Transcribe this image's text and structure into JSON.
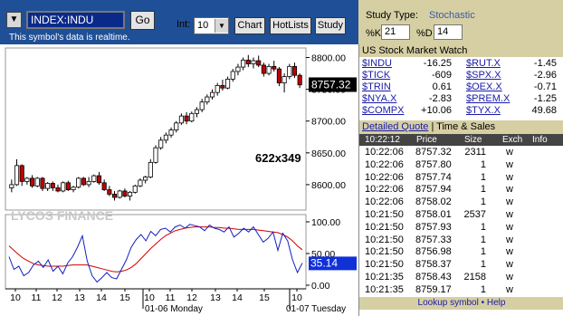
{
  "toolbar": {
    "menu_icon": "▼",
    "symbol_value": "INDEX:INDU",
    "go_label": "Go",
    "realtime_text": "This symbol's data is realtime.",
    "int_label": "Int:",
    "int_value": "10",
    "chart_label": "Chart",
    "hotlists_label": "HotLists",
    "study_label": "Study"
  },
  "study": {
    "type_label": "Study Type:",
    "type_value": "Stochastic",
    "k_label": "%K",
    "k_value": "21",
    "d_label": "%D",
    "d_value": "14"
  },
  "chart": {
    "price_label": "8757.32",
    "stoch_label": "35.14",
    "size_text": "622x349",
    "watermark": "LYCOS FINANCE",
    "price_ticks": [
      "8800.00",
      "8750.00",
      "8700.00",
      "8650.00",
      "8600.00"
    ],
    "stoch_ticks": [
      "100.00",
      "50.00",
      "0.00"
    ],
    "x_ticks": [
      "10",
      "11",
      "12",
      "13",
      "14",
      "15",
      "10",
      "11",
      "12",
      "13",
      "14",
      "15",
      "10"
    ],
    "day1": "01-06 Monday",
    "day2": "01-07 Tuesday"
  },
  "chart_data": {
    "type": "candlestick",
    "price_ylim": [
      8560,
      8815
    ],
    "stoch_ylim": [
      0,
      100
    ],
    "current_price": 8757.32,
    "current_stoch": 35.14,
    "candles": [
      [
        8595,
        8608,
        8588,
        8600
      ],
      [
        8600,
        8640,
        8598,
        8630
      ],
      [
        8630,
        8632,
        8598,
        8605
      ],
      [
        8605,
        8612,
        8600,
        8610
      ],
      [
        8610,
        8615,
        8595,
        8598
      ],
      [
        8598,
        8612,
        8596,
        8610
      ],
      [
        8610,
        8612,
        8590,
        8594
      ],
      [
        8594,
        8604,
        8590,
        8602
      ],
      [
        8602,
        8605,
        8590,
        8595
      ],
      [
        8595,
        8600,
        8588,
        8590
      ],
      [
        8590,
        8605,
        8588,
        8603
      ],
      [
        8603,
        8606,
        8590,
        8592
      ],
      [
        8592,
        8598,
        8588,
        8596
      ],
      [
        8596,
        8612,
        8594,
        8610
      ],
      [
        8610,
        8612,
        8598,
        8600
      ],
      [
        8600,
        8612,
        8596,
        8605
      ],
      [
        8605,
        8616,
        8603,
        8614
      ],
      [
        8614,
        8620,
        8600,
        8603
      ],
      [
        8603,
        8608,
        8590,
        8592
      ],
      [
        8592,
        8598,
        8582,
        8585
      ],
      [
        8585,
        8590,
        8575,
        8580
      ],
      [
        8580,
        8592,
        8578,
        8590
      ],
      [
        8590,
        8594,
        8580,
        8582
      ],
      [
        8582,
        8590,
        8575,
        8588
      ],
      [
        8588,
        8600,
        8586,
        8598
      ],
      [
        8598,
        8610,
        8596,
        8607
      ],
      [
        8607,
        8614,
        8602,
        8612
      ],
      [
        8612,
        8640,
        8610,
        8635
      ],
      [
        8635,
        8662,
        8633,
        8658
      ],
      [
        8658,
        8675,
        8655,
        8670
      ],
      [
        8670,
        8682,
        8665,
        8678
      ],
      [
        8678,
        8690,
        8674,
        8686
      ],
      [
        8686,
        8700,
        8682,
        8697
      ],
      [
        8697,
        8712,
        8694,
        8708
      ],
      [
        8708,
        8714,
        8695,
        8700
      ],
      [
        8700,
        8715,
        8698,
        8712
      ],
      [
        8712,
        8722,
        8706,
        8718
      ],
      [
        8718,
        8735,
        8714,
        8730
      ],
      [
        8730,
        8742,
        8726,
        8738
      ],
      [
        8738,
        8750,
        8734,
        8745
      ],
      [
        8745,
        8760,
        8740,
        8756
      ],
      [
        8756,
        8765,
        8748,
        8752
      ],
      [
        8752,
        8770,
        8750,
        8766
      ],
      [
        8766,
        8782,
        8762,
        8778
      ],
      [
        8778,
        8790,
        8772,
        8785
      ],
      [
        8785,
        8800,
        8780,
        8796
      ],
      [
        8796,
        8804,
        8785,
        8790
      ],
      [
        8790,
        8800,
        8783,
        8795
      ],
      [
        8795,
        8803,
        8785,
        8788
      ],
      [
        8788,
        8792,
        8770,
        8775
      ],
      [
        8775,
        8790,
        8772,
        8786
      ],
      [
        8786,
        8795,
        8778,
        8782
      ],
      [
        8782,
        8785,
        8755,
        8760
      ],
      [
        8760,
        8775,
        8745,
        8770
      ],
      [
        8770,
        8790,
        8766,
        8786
      ],
      [
        8786,
        8792,
        8768,
        8772
      ],
      [
        8772,
        8775,
        8752,
        8757
      ]
    ],
    "stoch_k": [
      45,
      25,
      30,
      15,
      20,
      32,
      38,
      28,
      40,
      22,
      30,
      18,
      35,
      45,
      60,
      78,
      38,
      15,
      5,
      12,
      20,
      12,
      10,
      25,
      40,
      60,
      72,
      80,
      70,
      85,
      78,
      88,
      90,
      84,
      92,
      95,
      90,
      96,
      94,
      92,
      86,
      95,
      90,
      88,
      84,
      92,
      76,
      82,
      90,
      84,
      92,
      80,
      68,
      74,
      84,
      55,
      82,
      70,
      40,
      20,
      35
    ],
    "stoch_d": [
      62,
      55,
      48,
      42,
      38,
      34,
      32,
      31,
      30,
      30,
      30,
      30,
      31,
      32,
      32,
      32,
      32,
      30,
      28,
      26,
      24,
      22,
      21,
      22,
      24,
      28,
      34,
      42,
      50,
      58,
      65,
      72,
      78,
      82,
      86,
      88,
      90,
      91,
      92,
      92,
      92,
      92,
      91,
      91,
      90,
      90,
      89,
      88,
      88,
      88,
      88,
      87,
      86,
      85,
      84,
      83,
      80,
      76,
      70,
      62,
      56
    ]
  },
  "watch": {
    "title": "US Stock Market Watch",
    "rows": [
      {
        "s1": "$INDU",
        "v1": "-16.25",
        "s2": "$RUT.X",
        "v2": "-1.45"
      },
      {
        "s1": "$TICK",
        "v1": "-609",
        "s2": "$SPX.X",
        "v2": "-2.96"
      },
      {
        "s1": "$TRIN",
        "v1": "0.61",
        "s2": "$OEX.X",
        "v2": "-0.71"
      },
      {
        "s1": "$NYA.X",
        "v1": "-2.83",
        "s2": "$PREM.X",
        "v2": "-1.25"
      },
      {
        "s1": "$COMPX",
        "v1": "+10.06",
        "s2": "$TYX.X",
        "v2": "49.68"
      }
    ]
  },
  "quote_tabs": {
    "detailed": "Detailed Quote",
    "sep": "|",
    "time_sales": "Time & Sales"
  },
  "quote_header": {
    "time": "10:22:12",
    "price": "Price",
    "size": "Size",
    "exch": "Exch",
    "info": "Info"
  },
  "trades": [
    {
      "time": "10:22:06",
      "price": "8757.32",
      "size": "2311",
      "exch": "w"
    },
    {
      "time": "10:22:06",
      "price": "8757.80",
      "size": "1",
      "exch": "w"
    },
    {
      "time": "10:22:06",
      "price": "8757.74",
      "size": "1",
      "exch": "w"
    },
    {
      "time": "10:22:06",
      "price": "8757.94",
      "size": "1",
      "exch": "w"
    },
    {
      "time": "10:22:06",
      "price": "8758.02",
      "size": "1",
      "exch": "w"
    },
    {
      "time": "10:21:50",
      "price": "8758.01",
      "size": "2537",
      "exch": "w"
    },
    {
      "time": "10:21:50",
      "price": "8757.93",
      "size": "1",
      "exch": "w"
    },
    {
      "time": "10:21:50",
      "price": "8757.33",
      "size": "1",
      "exch": "w"
    },
    {
      "time": "10:21:50",
      "price": "8756.98",
      "size": "1",
      "exch": "w"
    },
    {
      "time": "10:21:50",
      "price": "8758.37",
      "size": "1",
      "exch": "w"
    },
    {
      "time": "10:21:35",
      "price": "8758.43",
      "size": "2158",
      "exch": "w"
    },
    {
      "time": "10:21:35",
      "price": "8759.17",
      "size": "1",
      "exch": "w"
    }
  ],
  "footer": {
    "lookup": "Lookup symbol",
    "bullet": "•",
    "help": "Help"
  }
}
